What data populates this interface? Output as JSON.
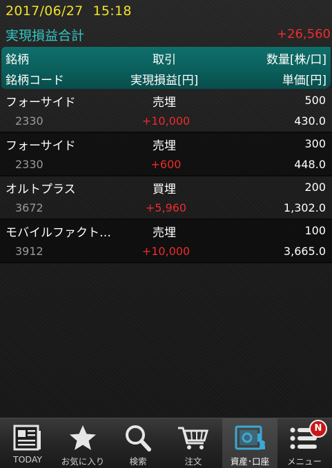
{
  "header": {
    "date": "2017/06/27",
    "time": "15:18",
    "total_label": "実現損益合計",
    "total_value": "+26,560"
  },
  "columns": {
    "name": "銘柄",
    "trade": "取引",
    "qty": "数量[株/口]",
    "code": "銘柄コード",
    "pl": "実現損益[円]",
    "price": "単価[円]"
  },
  "rows": [
    {
      "name": "フォーサイド",
      "trade": "売埋",
      "qty": "500",
      "code": "2330",
      "pl": "+10,000",
      "price": "430.0"
    },
    {
      "name": "フォーサイド",
      "trade": "売埋",
      "qty": "300",
      "code": "2330",
      "pl": "+600",
      "price": "448.0"
    },
    {
      "name": "オルトプラス",
      "trade": "買埋",
      "qty": "200",
      "code": "3672",
      "pl": "+5,960",
      "price": "1,302.0"
    },
    {
      "name": "モバイルファクト…",
      "trade": "売埋",
      "qty": "100",
      "code": "3912",
      "pl": "+10,000",
      "price": "3,665.0"
    }
  ],
  "tabs": [
    {
      "label": "TODAY",
      "icon": "newspaper-icon"
    },
    {
      "label": "お気に入り",
      "icon": "star-icon"
    },
    {
      "label": "検索",
      "icon": "search-icon"
    },
    {
      "label": "注文",
      "icon": "cart-icon"
    },
    {
      "label": "資産･口座",
      "icon": "safe-icon"
    },
    {
      "label": "メニュー",
      "icon": "menu-icon"
    }
  ],
  "badge": "N",
  "colors": {
    "date": "#f0e22a",
    "total_label": "#31c7c1",
    "profit": "#ee2b2b",
    "header_bg": "#0b5f5c",
    "active_tab_icon": "#3aa9d6"
  }
}
